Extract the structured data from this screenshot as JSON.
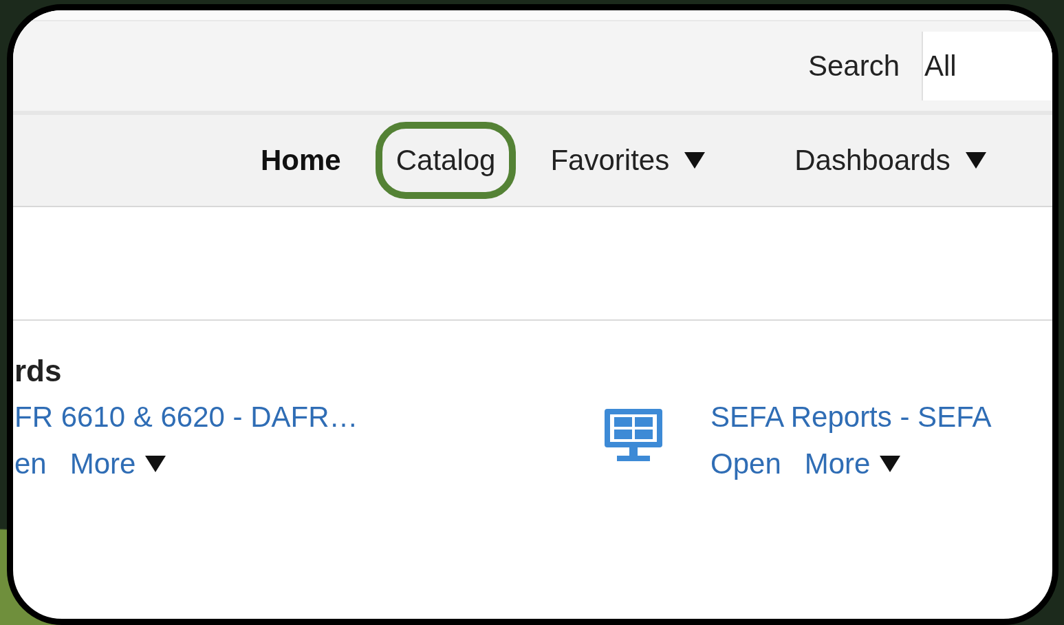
{
  "search": {
    "label": "Search",
    "value": "All"
  },
  "nav": [
    {
      "label": "Home",
      "selected": true,
      "highlighted": false,
      "dropdown": false
    },
    {
      "label": "Catalog",
      "selected": false,
      "highlighted": true,
      "dropdown": false
    },
    {
      "label": "Favorites",
      "selected": false,
      "highlighted": false,
      "dropdown": true
    },
    {
      "label": "Dashboards",
      "selected": false,
      "highlighted": false,
      "dropdown": true
    }
  ],
  "section": {
    "title": "rds",
    "items": [
      {
        "title": "FR 6610 & 6620 - DAFR…",
        "icon": false,
        "actions": [
          {
            "label": "en",
            "dropdown": false
          },
          {
            "label": "More",
            "dropdown": true
          }
        ]
      },
      {
        "title": "SEFA Reports - SEFA",
        "icon": true,
        "actions": [
          {
            "label": "Open",
            "dropdown": false
          },
          {
            "label": "More",
            "dropdown": true
          }
        ]
      }
    ]
  }
}
